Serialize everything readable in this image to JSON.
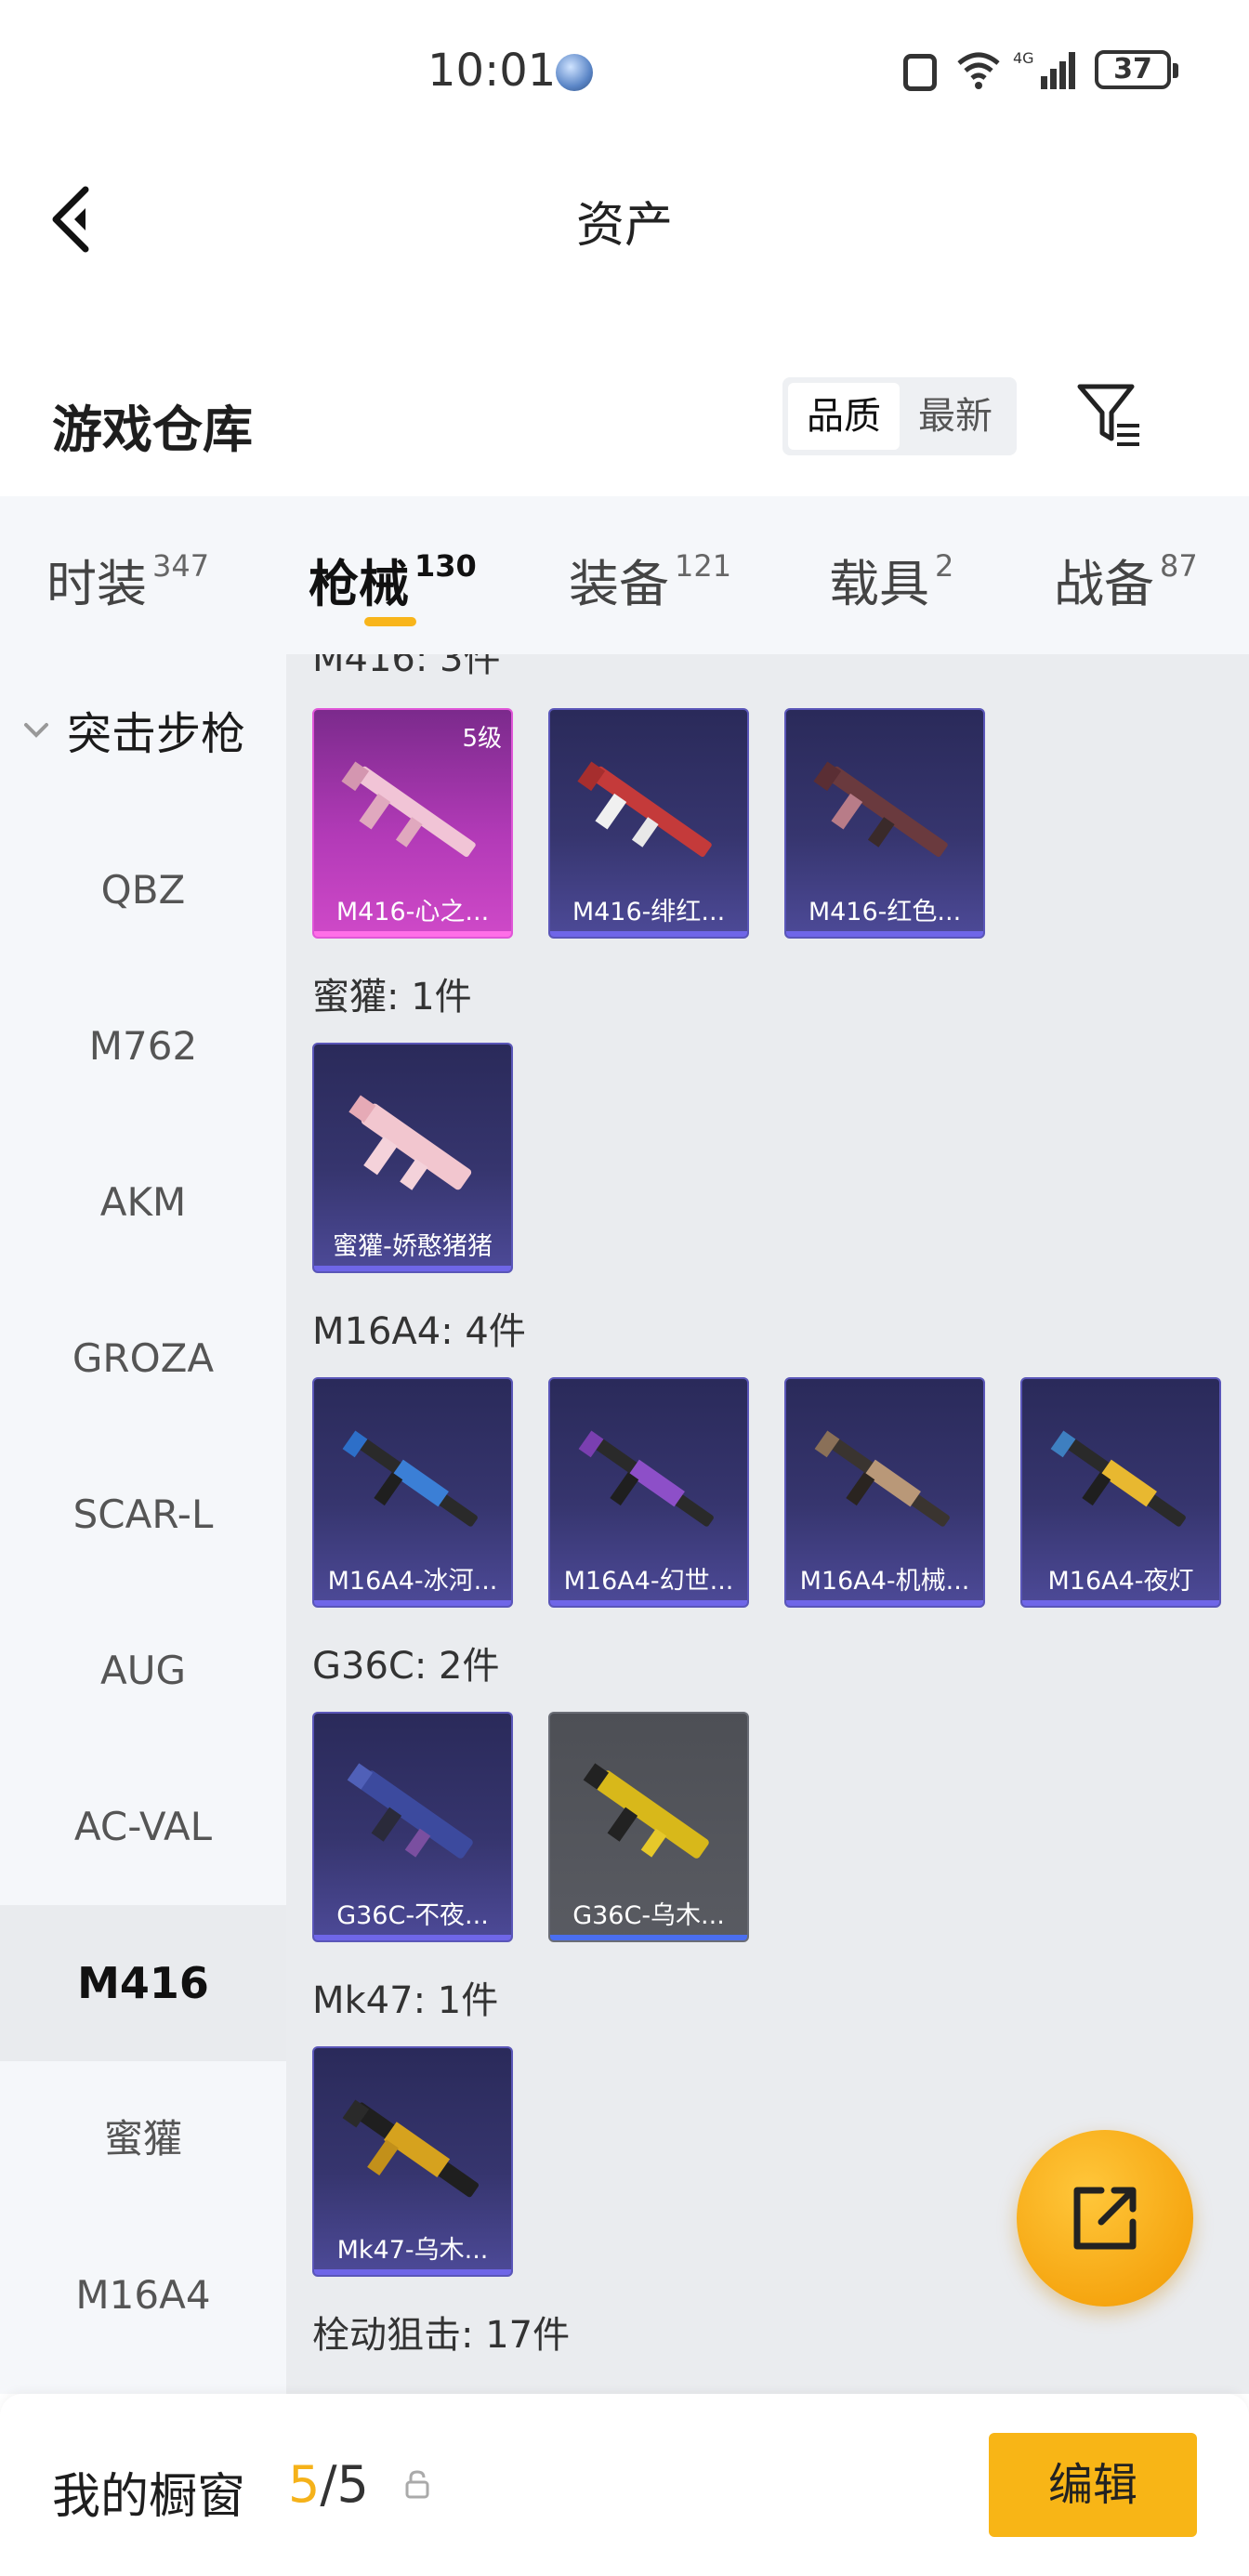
{
  "status_bar": {
    "time": "10:01",
    "battery": "37",
    "network": "4G"
  },
  "nav": {
    "title": "资产"
  },
  "warehouse": {
    "title": "游戏仓库",
    "sort_options": [
      "品质",
      "最新"
    ],
    "active_sort": "品质"
  },
  "tabs": [
    {
      "label": "时装",
      "count": "347"
    },
    {
      "label": "枪械",
      "count": "130",
      "active": true
    },
    {
      "label": "装备",
      "count": "121"
    },
    {
      "label": "载具",
      "count": "2"
    },
    {
      "label": "战备",
      "count": "87"
    }
  ],
  "sidebar": {
    "category": "突击步枪",
    "items": [
      "QBZ",
      "M762",
      "AKM",
      "GROZA",
      "SCAR-L",
      "AUG",
      "AC-VAL",
      "M416",
      "蜜獾",
      "M16A4"
    ],
    "active": "M416"
  },
  "groups": [
    {
      "label": "M416: 3件",
      "items": [
        {
          "name": "M416-心之...",
          "level": "5级",
          "style": "pink"
        },
        {
          "name": "M416-绯红...",
          "style": "purple"
        },
        {
          "name": "M416-红色...",
          "style": "purple"
        }
      ]
    },
    {
      "label": "蜜獾: 1件",
      "items": [
        {
          "name": "蜜獾-娇憨猪猪",
          "style": "purple"
        }
      ]
    },
    {
      "label": "M16A4: 4件",
      "items": [
        {
          "name": "M16A4-冰河...",
          "style": "purple"
        },
        {
          "name": "M16A4-幻世...",
          "style": "purple"
        },
        {
          "name": "M16A4-机械...",
          "style": "purple"
        },
        {
          "name": "M16A4-夜灯",
          "style": "purple"
        }
      ]
    },
    {
      "label": "G36C: 2件",
      "items": [
        {
          "name": "G36C-不夜...",
          "style": "purple"
        },
        {
          "name": "G36C-乌木...",
          "style": "grey"
        }
      ]
    },
    {
      "label": "Mk47: 1件",
      "items": [
        {
          "name": "Mk47-乌木...",
          "style": "purple"
        }
      ]
    },
    {
      "label": "栓动狙击: 17件",
      "items": []
    }
  ],
  "fab": {
    "icon": "share-external-icon"
  },
  "bottom_bar": {
    "label": "我的橱窗",
    "current": "5",
    "total": "/5",
    "edit_label": "编辑"
  },
  "colors": {
    "accent": "#f8b516",
    "card_purple": "#36356e",
    "card_pink": "#b23ab7",
    "card_grey": "#595b62"
  }
}
